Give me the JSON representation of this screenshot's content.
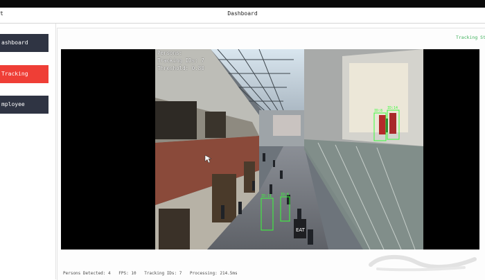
{
  "header": {
    "left_title": "t",
    "center_title": "Dashboard"
  },
  "sidebar": {
    "items": [
      {
        "label": "ashboard"
      },
      {
        "label": "Tracking"
      },
      {
        "label": "mployee"
      }
    ]
  },
  "main": {
    "status_top": "Tracking St"
  },
  "video": {
    "overlay": [
      "Persons:",
      "Tracking IDs: 7",
      "Threshold: 0.80"
    ],
    "tracked_labels": [
      "ID:11",
      "ID:6",
      "ID:8",
      "ID:14"
    ]
  },
  "status_bar": {
    "persons": "Persons Detected: 4",
    "fps": "FPS: 10",
    "ids": "Tracking IDs: 7",
    "processing": "Processing: 214.5ms"
  },
  "colors": {
    "nav_dark": "#2f3443",
    "nav_active": "#ef3e36",
    "detection_box": "#39ff3a",
    "status_text": "#3db05a"
  }
}
